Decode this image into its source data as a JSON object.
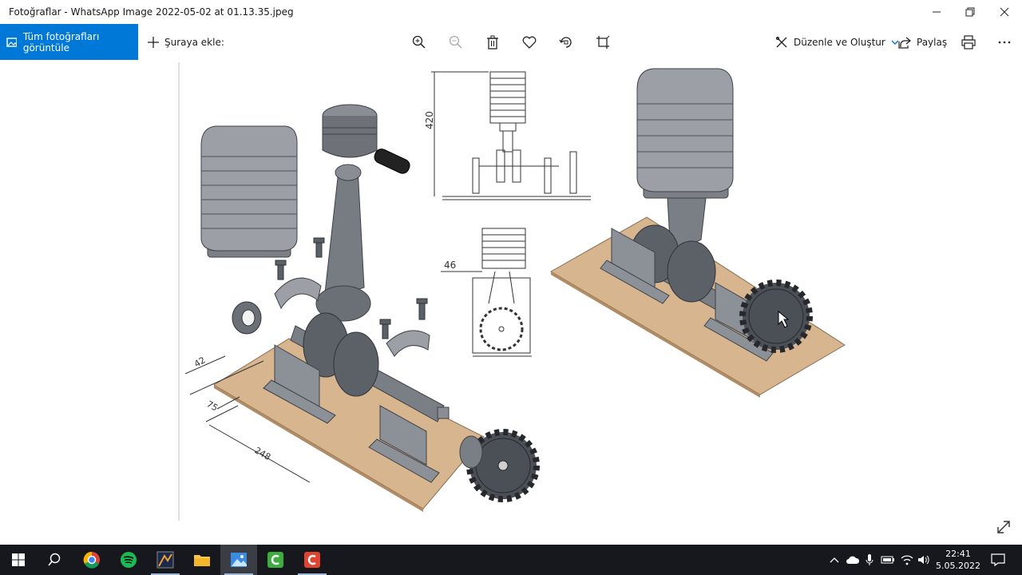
{
  "window": {
    "title": "Fotoğraflar - WhatsApp Image 2022-05-02 at 01.13.35.jpeg"
  },
  "toolbar": {
    "view_all_label": "Tüm fotoğrafları görüntüle",
    "add_to_label": "Şuraya ekle:",
    "edit_create_label": "Düzenle ve Oluştur",
    "share_label": "Paylaş"
  },
  "drawing": {
    "dimensions": {
      "height_420": "420",
      "offset_46": "46",
      "dim_42": "42",
      "dim_75": "75",
      "dim_248": "248"
    }
  },
  "taskbar": {
    "time": "22:41",
    "date": "5.05.2022",
    "colors": {
      "background": "#16181d",
      "accent": "#0078d7"
    }
  }
}
